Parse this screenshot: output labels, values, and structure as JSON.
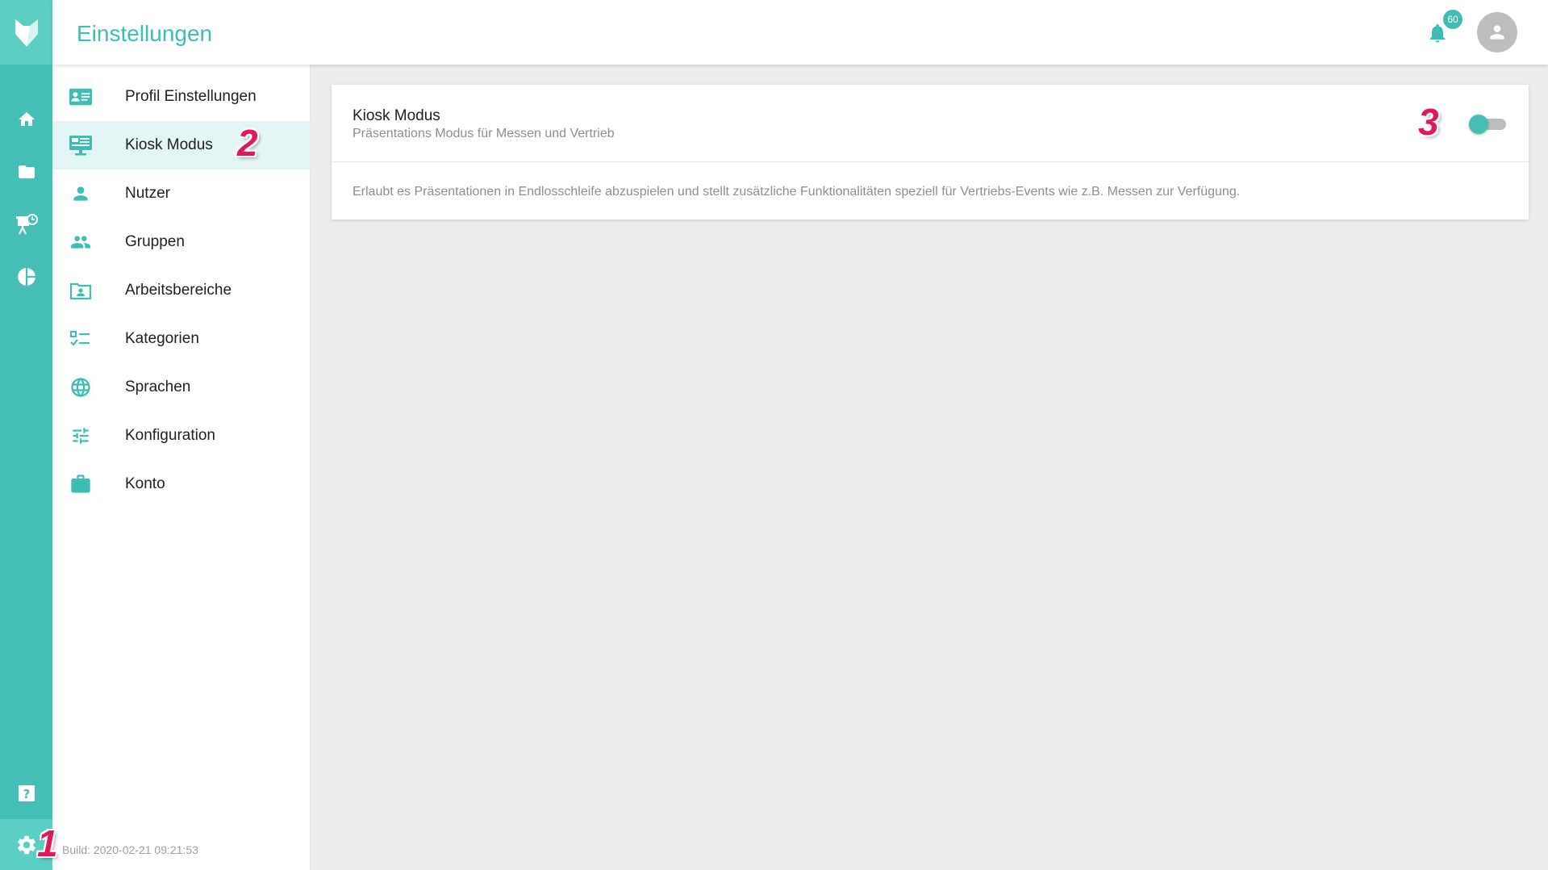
{
  "header": {
    "title": "Einstellungen",
    "notification_count": "60"
  },
  "rail": {
    "items": [
      "home-icon",
      "folder-icon",
      "presentation-icon",
      "pie-chart-icon",
      "help-icon",
      "settings-icon"
    ]
  },
  "subnav": {
    "items": [
      {
        "label": "Profil Einstellungen",
        "icon": "profile-card-icon"
      },
      {
        "label": "Kiosk Modus",
        "icon": "monitor-icon"
      },
      {
        "label": "Nutzer",
        "icon": "person-icon"
      },
      {
        "label": "Gruppen",
        "icon": "group-icon"
      },
      {
        "label": "Arbeitsbereiche",
        "icon": "workspace-icon"
      },
      {
        "label": "Kategorien",
        "icon": "checklist-icon"
      },
      {
        "label": "Sprachen",
        "icon": "globe-icon"
      },
      {
        "label": "Konfiguration",
        "icon": "sliders-icon"
      },
      {
        "label": "Konto",
        "icon": "briefcase-icon"
      }
    ],
    "active_index": 1
  },
  "build": "Build: 2020-02-21 09:21:53",
  "card": {
    "title": "Kiosk Modus",
    "subtitle": "Präsentations Modus für Messen und Vertrieb",
    "description": "Erlaubt es Präsentationen in Endlosschleife abzuspielen und stellt zusätzliche Funktionalitäten speziell für Vertriebs-Events wie z.B. Messen zur Verfügung.",
    "toggle_on": false
  },
  "markers": [
    "1",
    "2",
    "3"
  ],
  "colors": {
    "accent": "#45bfb5",
    "accent_light": "#5ccfc4",
    "marker": "#e0195e",
    "active_bg": "#e3f5f4"
  }
}
